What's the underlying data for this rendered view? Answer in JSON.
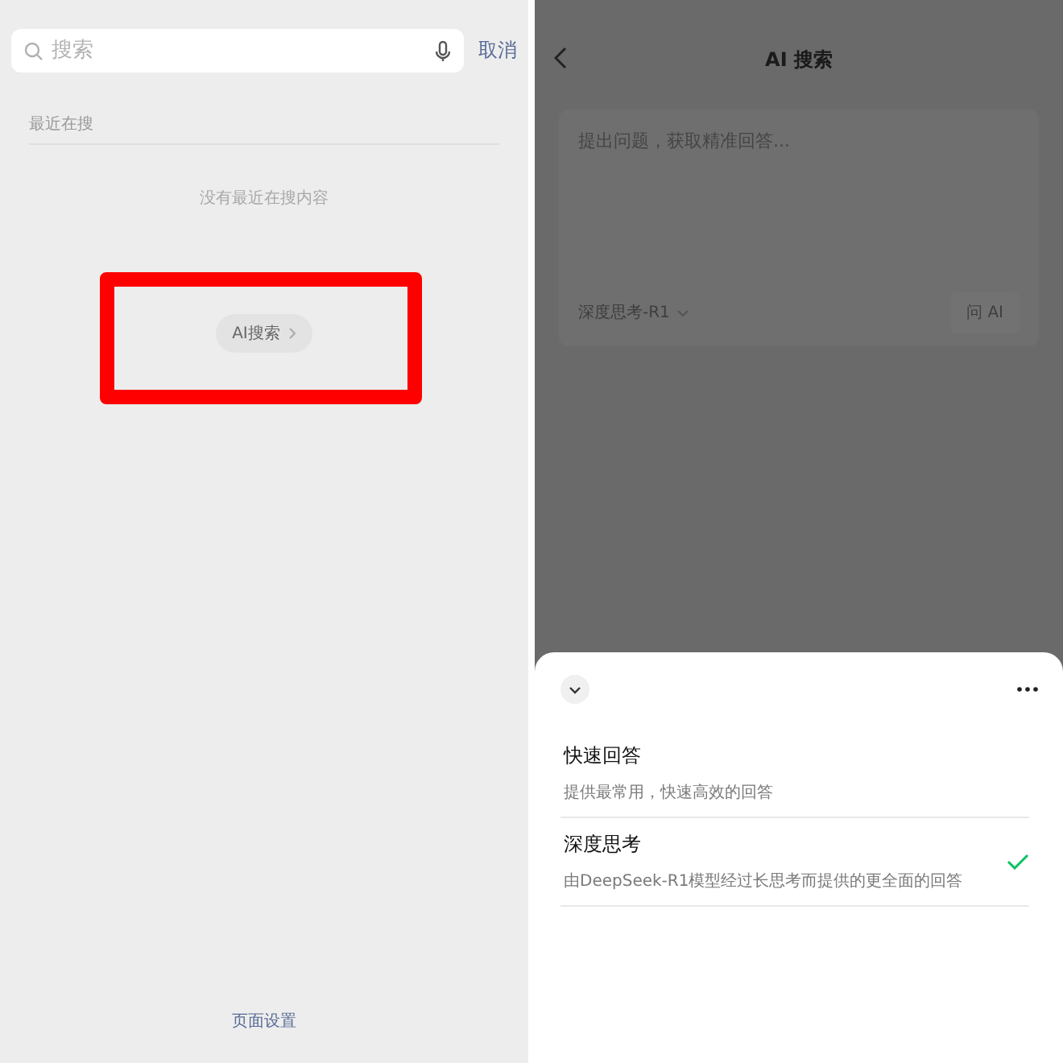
{
  "search_page": {
    "search": {
      "placeholder": "搜索"
    },
    "cancel": "取消",
    "recent_label": "最近在搜",
    "empty_text": "没有最近在搜内容",
    "ai_search_button": "AI搜索",
    "highlight": true,
    "footer_link": "页面设置"
  },
  "ai_page": {
    "title": "AI 搜索",
    "input": {
      "placeholder": "提出问题，获取精准回答..."
    },
    "model_selector": "深度思考-R1",
    "ask_button": "问 AI",
    "sheet": {
      "options": [
        {
          "title": "快速回答",
          "description": "提供最常用，快速高效的回答",
          "selected": false
        },
        {
          "title": "深度思考",
          "description": "由DeepSeek-R1模型经过长思考而提供的更全面的回答",
          "selected": true
        }
      ]
    }
  }
}
